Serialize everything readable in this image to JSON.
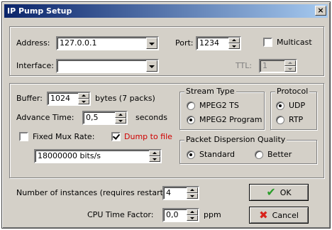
{
  "window": {
    "title": "IP Pump Setup",
    "close_label": "×"
  },
  "network": {
    "address_label": "Address:",
    "address_value": "127.0.0.1",
    "port_label": "Port:",
    "port_value": "1234",
    "multicast_label": "Multicast",
    "multicast_checked": false,
    "interface_label": "Interface:",
    "interface_value": "",
    "ttl_label": "TTL:",
    "ttl_value": "1"
  },
  "stream": {
    "buffer_label": "Buffer:",
    "buffer_value": "1024",
    "buffer_unit": "bytes (7 packs)",
    "advance_label": "Advance Time:",
    "advance_value": "0,5",
    "advance_unit": "seconds",
    "fixed_mux_label": "Fixed Mux Rate:",
    "fixed_mux_checked": false,
    "dump_label": "Dump to file",
    "dump_checked": true,
    "dump_color": "#d00000",
    "mux_rate_value": "18000000 bits/s"
  },
  "stream_type": {
    "legend": "Stream Type",
    "options": [
      "MPEG2 TS",
      "MPEG2 Program"
    ],
    "selected": "MPEG2 Program"
  },
  "protocol": {
    "legend": "Protocol",
    "options": [
      "UDP",
      "RTP"
    ],
    "selected": "UDP"
  },
  "dispersion": {
    "legend": "Packet Dispersion Quality",
    "options": [
      "Standard",
      "Better"
    ],
    "selected": "Standard"
  },
  "bottom": {
    "instances_label": "Number of instances (requires restart):",
    "instances_value": "4",
    "cpu_label": "CPU Time Factor:",
    "cpu_value": "0,0",
    "cpu_unit": "ppm"
  },
  "buttons": {
    "ok_label": "OK",
    "cancel_label": "Cancel"
  },
  "icons": {
    "ok": "checkmark-icon",
    "cancel": "x-icon"
  },
  "colors": {
    "title_start": "#0a246a",
    "title_end": "#a6caf0",
    "face": "#d4d0c8"
  }
}
